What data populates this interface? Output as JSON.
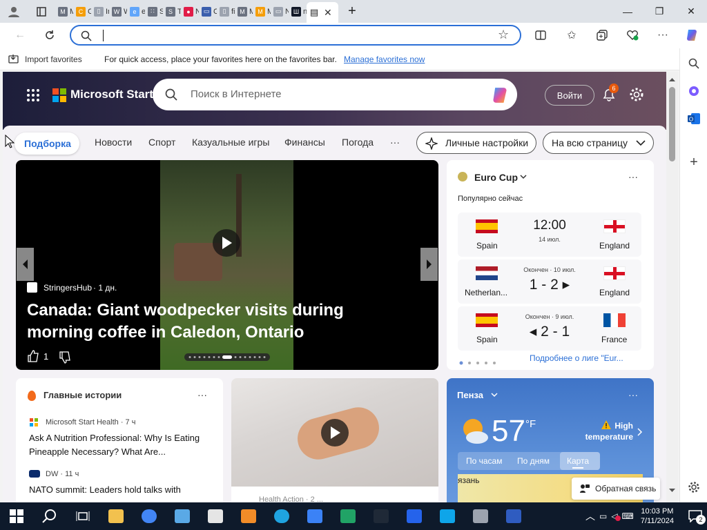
{
  "browser": {
    "tabs": [
      {
        "title": "MS",
        "color": "#6b7280",
        "glyph": "M"
      },
      {
        "title": "Ch",
        "color": "#f59e0b",
        "glyph": "C"
      },
      {
        "title": "Inc",
        "color": "#9ca3af",
        "glyph": "▯"
      },
      {
        "title": "Wi",
        "color": "#6b7280",
        "glyph": "W"
      },
      {
        "title": "em",
        "color": "#60a5fa",
        "glyph": "e"
      },
      {
        "title": "Sn",
        "color": "#6b7280",
        "glyph": "∷"
      },
      {
        "title": "TV",
        "color": "#6b7280",
        "glyph": "S"
      },
      {
        "title": "Ne",
        "color": "#e11d48",
        "glyph": "●"
      },
      {
        "title": "Op",
        "color": "#3b5fad",
        "glyph": "▭"
      },
      {
        "title": "file",
        "color": "#9ca3af",
        "glyph": "▯"
      },
      {
        "title": "MS",
        "color": "#6b7280",
        "glyph": "M"
      },
      {
        "title": "Mi",
        "color": "#f59e0b",
        "glyph": "M"
      },
      {
        "title": "Ne",
        "color": "#9ca3af",
        "glyph": "▭"
      },
      {
        "title": "no",
        "color": "#111827",
        "glyph": "Ш"
      }
    ],
    "active_tab_glyph": "▤",
    "close_tab": "✕",
    "new_tab": "+",
    "window": {
      "minimize": "—",
      "maximize": "❐",
      "close": "✕"
    },
    "address_value": "",
    "favorites_bar": {
      "import_label": "Import favorites",
      "message": "For quick access, place your favorites here on the favorites bar.",
      "manage_link": "Manage favorites now"
    }
  },
  "start": {
    "brand": "Microsoft Start",
    "search_placeholder": "Поиск в Интернете",
    "signin_label": "Войти",
    "notification_count": "6",
    "nav": {
      "items": [
        "Подборка",
        "Новости",
        "Спорт",
        "Казуальные игры",
        "Финансы",
        "Погода",
        "···"
      ],
      "personalize": "Личные настройки",
      "layout": "На всю страницу"
    },
    "featured": {
      "source": "StringersHub",
      "age": "· 1 дн.",
      "headline": "Canada: Giant woodpecker visits during morning coffee in Caledon, Ontario",
      "likes": "1"
    },
    "euro": {
      "title": "Euro Cup",
      "subtitle": "Популярно сейчас",
      "matches": [
        {
          "home": "Spain",
          "away": "England",
          "status": "",
          "score": "12:00",
          "date": "14 июл."
        },
        {
          "home": "Netherlan...",
          "away": "England",
          "status": "Окончен · 10 июл.",
          "score": "1 - 2 ▸",
          "date": ""
        },
        {
          "home": "Spain",
          "away": "France",
          "status": "Окончен · 9 июл.",
          "score": "◂ 2 - 1",
          "date": ""
        }
      ],
      "more_link": "Подробнее о лиге \"Eur..."
    },
    "top_stories": {
      "title": "Главные истории",
      "items": [
        {
          "source": "Microsoft Start Health · 7 ч",
          "headline": "Ask A Nutrition Professional: Why Is Eating Pineapple Necessary? What Are..."
        },
        {
          "source": "DW · 11 ч",
          "headline": "NATO summit: Leaders hold talks with"
        }
      ]
    },
    "video_card": {
      "source": "Health Action · 2 ..."
    },
    "weather": {
      "city": "Пенза",
      "temp": "57",
      "unit": "°F",
      "alert": "High temperature",
      "tabs": [
        "По часам",
        "По дням",
        "Карта"
      ],
      "map_label": "язань"
    },
    "feedback_label": "Обратная связь"
  },
  "taskbar": {
    "time": "10:03 PM",
    "date": "7/11/2024",
    "notif_count": "2",
    "apps": [
      "file-explorer-icon",
      "chrome-icon",
      "virtualbox-icon",
      "7zip-icon",
      "tool-icon",
      "edge-icon",
      "network-icon",
      "excel-icon",
      "terminal-icon",
      "app-icon",
      "rdp-icon",
      "phone-icon",
      "powershell-icon"
    ]
  },
  "colors": {
    "accent": "#2b6fd6",
    "taskbar": "#0e1a2b",
    "hero": "#3b304f"
  }
}
